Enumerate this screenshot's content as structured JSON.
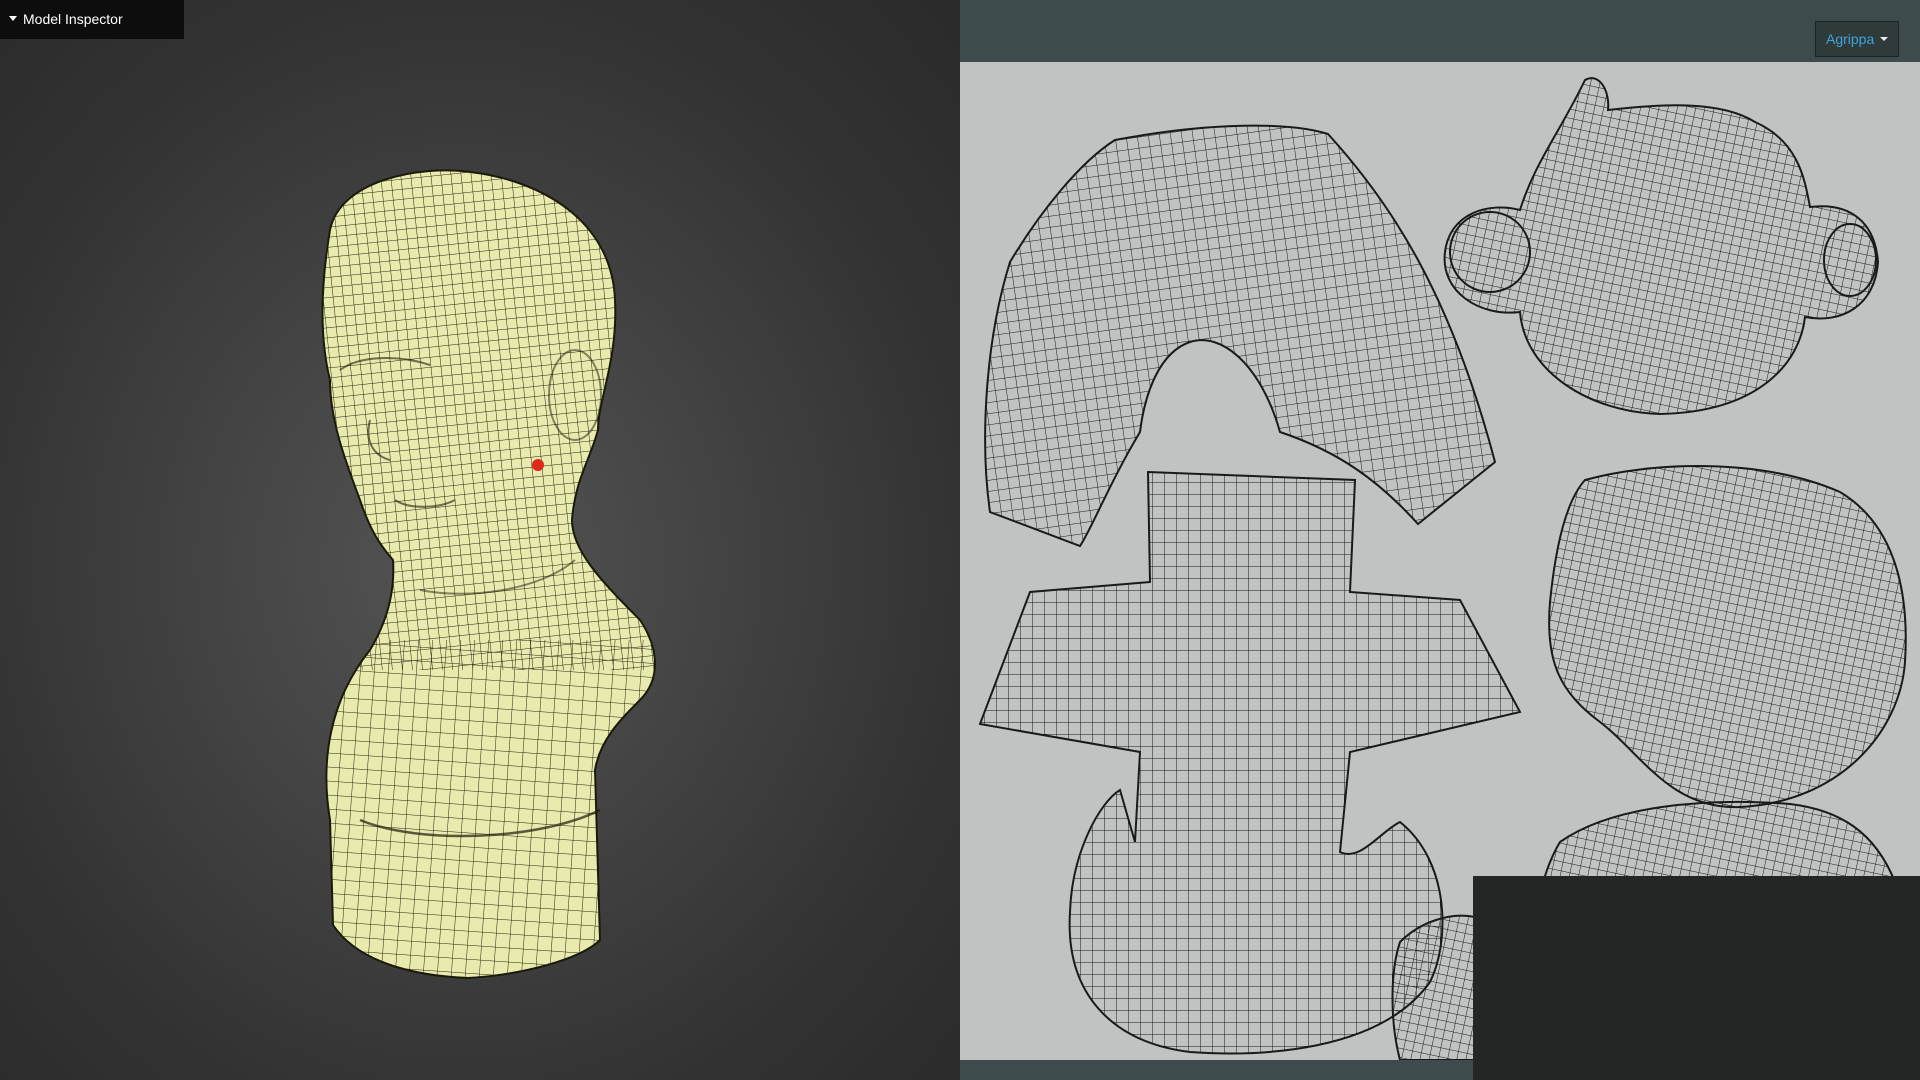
{
  "inspector": {
    "title": "Model Inspector"
  },
  "model_select": {
    "selected": "Agrippa"
  },
  "colors": {
    "mesh_fill": "#e9eaae",
    "mesh_wire": "#1e1f10",
    "vertex_marker": "#e0291a",
    "uv_background": "#bfc3c2",
    "uv_wire": "#1a1a1a",
    "accent": "#3fa5d9"
  }
}
